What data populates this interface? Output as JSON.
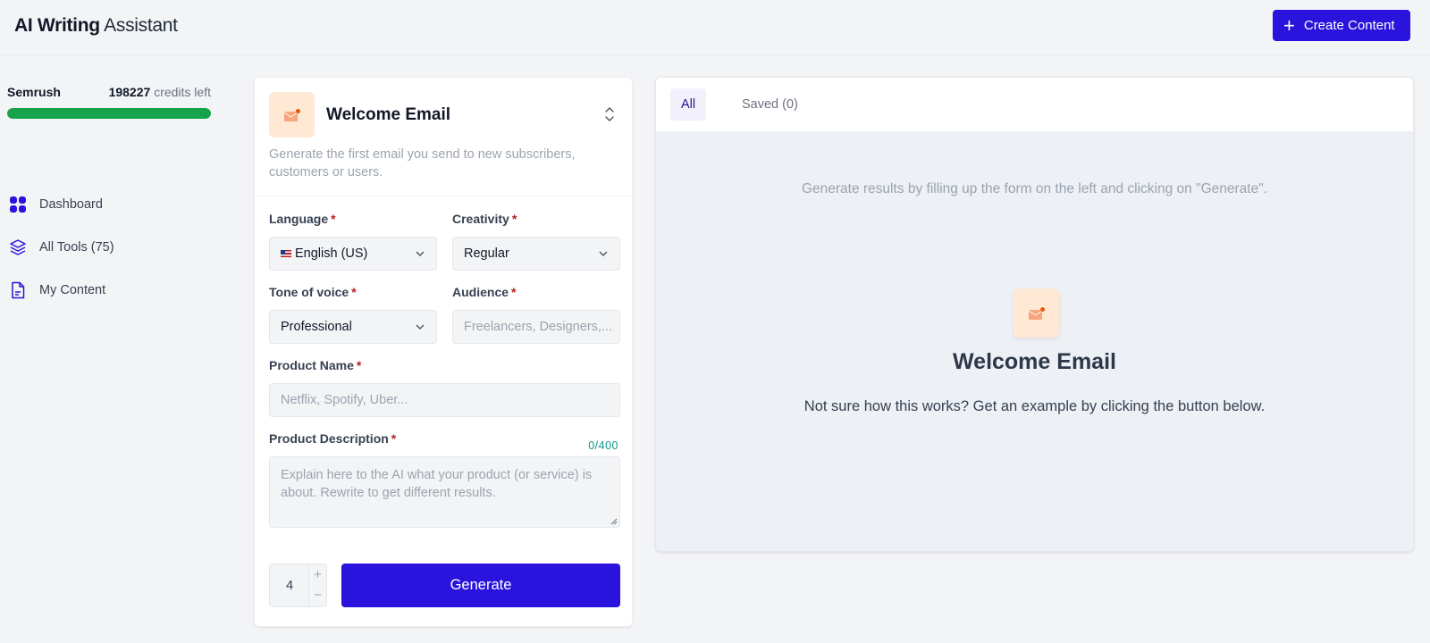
{
  "header": {
    "title_bold": "AI Writing",
    "title_light": "Assistant",
    "create_button": {
      "icon": "plus-icon",
      "label": "Create Content"
    }
  },
  "credits": {
    "brand": "Semrush",
    "amount": "198227",
    "label": "credits left",
    "bar_fill_percent": 100,
    "bar_color": "#16a34a"
  },
  "sidebar": {
    "items": [
      {
        "icon": "grid-icon",
        "label": "Dashboard"
      },
      {
        "icon": "layers-icon",
        "label": "All Tools (75)"
      },
      {
        "icon": "document-icon",
        "label": "My Content"
      }
    ]
  },
  "form": {
    "tool": {
      "icon": "mail-icon",
      "title": "Welcome Email",
      "description": "Generate the first email you send to new subscribers, customers or users."
    },
    "required_marker": "*",
    "language": {
      "label": "Language",
      "value": "English (US)",
      "flag": "us-flag"
    },
    "creativity": {
      "label": "Creativity",
      "value": "Regular"
    },
    "tone": {
      "label": "Tone of voice",
      "value": "Professional"
    },
    "audience": {
      "label": "Audience",
      "value": "",
      "placeholder": "Freelancers, Designers,..."
    },
    "product_name": {
      "label": "Product Name",
      "value": "",
      "placeholder": "Netflix, Spotify, Uber..."
    },
    "product_description": {
      "label": "Product Description",
      "value": "",
      "placeholder": "Explain here to the AI what your product (or service) is about. Rewrite to get different results.",
      "counter": "0/400"
    },
    "quantity": {
      "value": "4",
      "increment": "+",
      "decrement": "−"
    },
    "generate_label": "Generate",
    "accent_color": "#2a13dc"
  },
  "results": {
    "tabs": [
      {
        "label": "All",
        "active": true
      },
      {
        "label": "Saved (0)",
        "active": false
      }
    ],
    "hint": "Generate results by filling up the form on the left and clicking on \"Generate\".",
    "empty_icon": "mail-icon",
    "empty_title": "Welcome Email",
    "empty_subtitle": "Not sure how this works? Get an example by clicking the button below."
  }
}
